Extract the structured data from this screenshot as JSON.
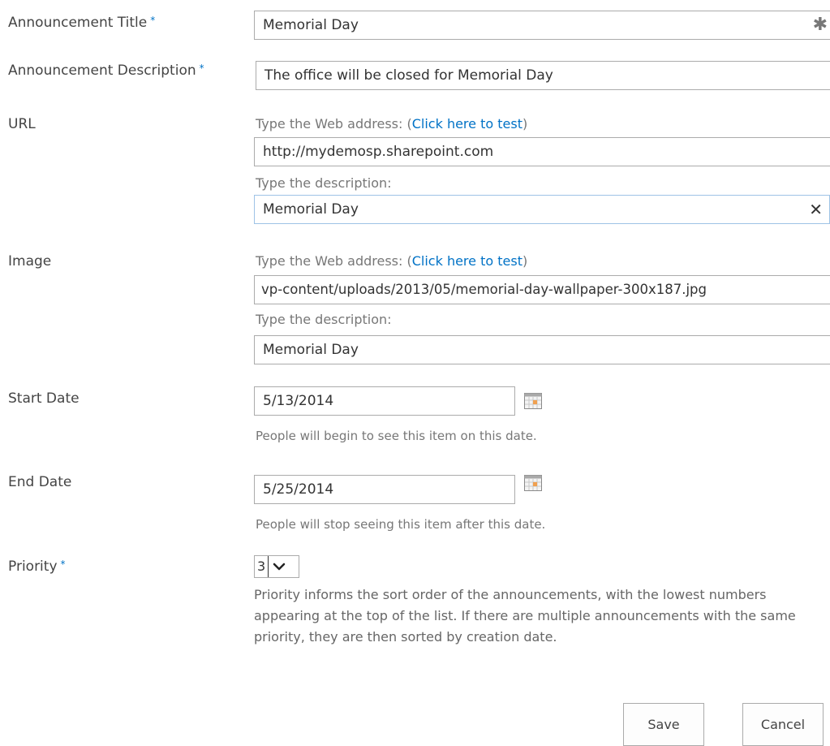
{
  "fields": {
    "title": {
      "label": "Announcement Title",
      "required": "*",
      "value": "Memorial Day"
    },
    "description": {
      "label": "Announcement Description",
      "required": "*",
      "value": "The office will be closed for Memorial Day"
    },
    "url": {
      "label": "URL",
      "address_hint": "Type the Web address: (",
      "test_link": "Click here to test",
      "address_hint_close": ")",
      "address_value": "http://mydemosp.sharepoint.com",
      "description_hint": "Type the description:",
      "description_value": "Memorial Day"
    },
    "image": {
      "label": "Image",
      "address_hint": "Type the Web address: (",
      "test_link": "Click here to test",
      "address_hint_close": ")",
      "address_value": "vp-content/uploads/2013/05/memorial-day-wallpaper-300x187.jpg",
      "description_hint": "Type the description:",
      "description_value": "Memorial Day"
    },
    "start_date": {
      "label": "Start Date",
      "value": "5/13/2014",
      "hint": "People will begin to see this item on this date."
    },
    "end_date": {
      "label": "End Date",
      "value": "5/25/2014",
      "hint": "People will stop seeing this item after this date."
    },
    "priority": {
      "label": "Priority",
      "required": "*",
      "value": "3",
      "description": "Priority informs the sort order of the announcements, with the lowest numbers appearing at the top of the list. If there are multiple announcements with the same priority, they are then sorted by creation date."
    }
  },
  "buttons": {
    "save": "Save",
    "cancel": "Cancel"
  },
  "icons": {
    "title_field": "asterisk-icon",
    "url_description_field": "close-icon",
    "calendar": "calendar-icon",
    "dropdown": "chevron-down-icon"
  },
  "colors": {
    "required_marker": "#0072c6",
    "link": "#0072c6",
    "label_text": "#444444",
    "hint_text": "#777777"
  }
}
